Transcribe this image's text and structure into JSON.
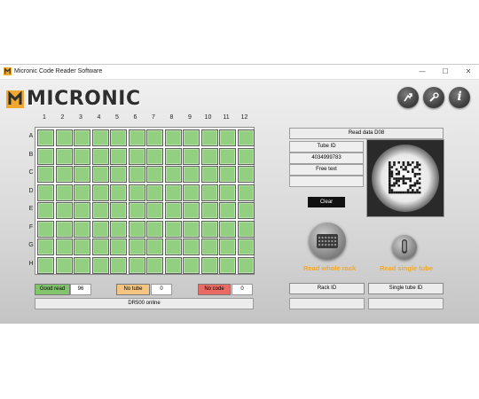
{
  "window": {
    "title": "Micronic Code Reader Software",
    "minimize": "—",
    "maximize": "☐",
    "close": "✕"
  },
  "logo": {
    "text": "MICRONIC"
  },
  "toolbar": {
    "buttons": [
      {
        "icon": "export-icon"
      },
      {
        "icon": "wrench-icon"
      },
      {
        "icon": "info-icon",
        "glyph": "i"
      }
    ]
  },
  "rack": {
    "columns": [
      "1",
      "2",
      "3",
      "4",
      "5",
      "6",
      "7",
      "8",
      "9",
      "10",
      "11",
      "12"
    ],
    "rows": [
      "A",
      "B",
      "C",
      "D",
      "E",
      "F",
      "G",
      "H"
    ],
    "well_status": "good-read",
    "well_color": "#93cf80"
  },
  "stats": {
    "good_read": {
      "label": "Good read",
      "value": "96",
      "color": "#82c46c"
    },
    "no_tube": {
      "label": "No tube",
      "value": "0",
      "color": "#f5c480"
    },
    "no_code": {
      "label": "No code",
      "value": "0",
      "color": "#ea6b64"
    }
  },
  "status": "DR500 online",
  "read_panel": {
    "header": "Read data D08",
    "tube_id_label": "Tube ID",
    "tube_id_value": "4034999783",
    "free_text_label": "Free text",
    "free_text_value": "",
    "clear_label": "Clear"
  },
  "actions": {
    "read_whole_rack": "Read whole rack",
    "read_single_tube": "Read single tube",
    "rack_id": "Rack ID",
    "single_tube_id": "Single tube ID"
  },
  "colors": {
    "accent": "#f0a830",
    "well": "#93cf80"
  }
}
